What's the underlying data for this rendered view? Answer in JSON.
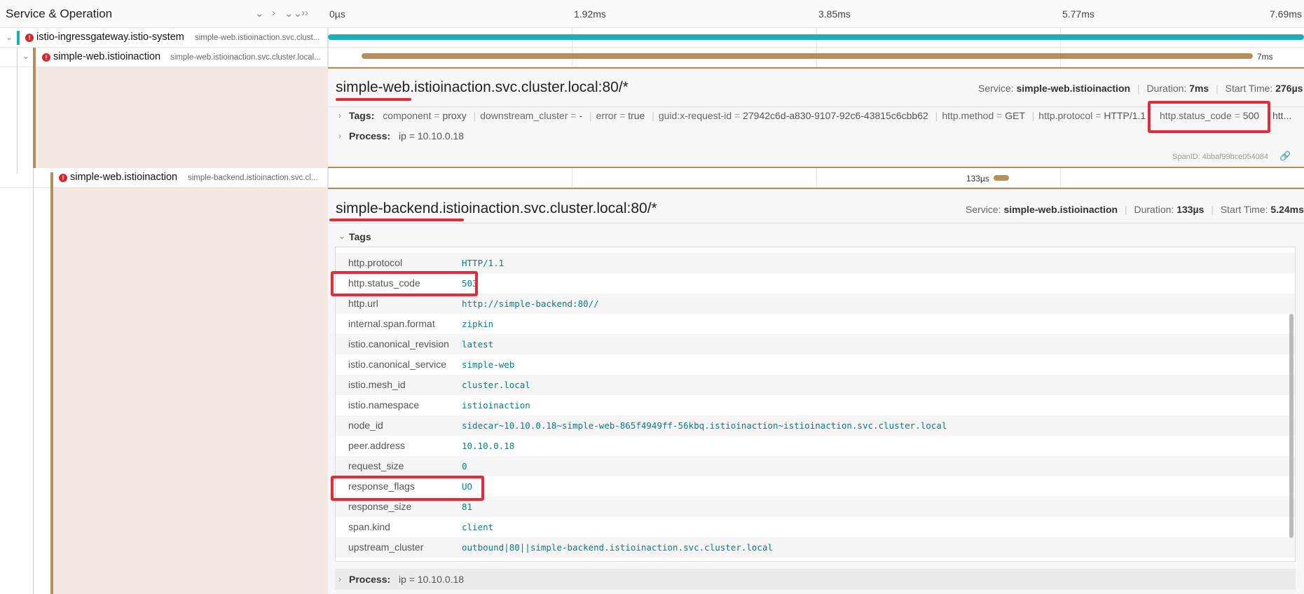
{
  "header": {
    "title": "Service & Operation",
    "controls": [
      "⌄",
      "›",
      "⌄⌄",
      "››"
    ],
    "ticks": [
      "0µs",
      "1.92ms",
      "3.85ms",
      "5.77ms",
      "7.69ms"
    ]
  },
  "spans": [
    {
      "service": "istio-ingressgateway.istio-system",
      "operation": "simple-web.istioinaction.svc.clust...",
      "color": "#1bb0b6"
    },
    {
      "service": "simple-web.istioinaction",
      "operation": "simple-web.istioinaction.svc.cluster.local...",
      "duration": "7ms",
      "color": "#b58e5e"
    },
    {
      "service": "simple-web.istioinaction",
      "operation": "simple-backend.istioinaction.svc.cl...",
      "duration": "133µs",
      "color": "#b58e5e"
    }
  ],
  "detail1": {
    "title": "simple-web.istioinaction.svc.cluster.local:80/*",
    "service_label": "Service:",
    "service": "simple-web.istioinaction",
    "duration_label": "Duration:",
    "duration": "7ms",
    "start_label": "Start Time:",
    "start": "276µs",
    "tags_label": "Tags:",
    "tags": [
      {
        "k": "component",
        "v": "proxy"
      },
      {
        "k": "downstream_cluster",
        "v": "-"
      },
      {
        "k": "error",
        "v": "true"
      },
      {
        "k": "guid:x-request-id",
        "v": "27942c6d-a830-9107-92c6-43815c6cbb62"
      },
      {
        "k": "http.method",
        "v": "GET"
      },
      {
        "k": "http.protocol",
        "v": "HTTP/1.1"
      },
      {
        "k": "http.status_code",
        "v": "500"
      }
    ],
    "tags_trailing": "htt...",
    "process_label": "Process:",
    "process": "ip = 10.10.0.18",
    "span_id": "SpanID: 4bbaf99bce054084"
  },
  "detail2": {
    "title": "simple-backend.istioinaction.svc.cluster.local:80/*",
    "service_label": "Service:",
    "service": "simple-web.istioinaction",
    "duration_label": "Duration:",
    "duration": "133µs",
    "start_label": "Start Time:",
    "start": "5.24ms",
    "tags_label": "Tags",
    "process_label": "Process:",
    "process": "ip = 10.10.0.18",
    "rows": [
      {
        "k": "http.protocol",
        "v": "HTTP/1.1"
      },
      {
        "k": "http.status_code",
        "v": "503"
      },
      {
        "k": "http.url",
        "v": "http://simple-backend:80//"
      },
      {
        "k": "internal.span.format",
        "v": "zipkin"
      },
      {
        "k": "istio.canonical_revision",
        "v": "latest"
      },
      {
        "k": "istio.canonical_service",
        "v": "simple-web"
      },
      {
        "k": "istio.mesh_id",
        "v": "cluster.local"
      },
      {
        "k": "istio.namespace",
        "v": "istioinaction"
      },
      {
        "k": "node_id",
        "v": "sidecar~10.10.0.18~simple-web-865f4949ff-56kbq.istioinaction~istioinaction.svc.cluster.local"
      },
      {
        "k": "peer.address",
        "v": "10.10.0.18"
      },
      {
        "k": "request_size",
        "v": "0"
      },
      {
        "k": "response_flags",
        "v": "UO"
      },
      {
        "k": "response_size",
        "v": "81"
      },
      {
        "k": "span.kind",
        "v": "client"
      },
      {
        "k": "upstream_cluster",
        "v": "outbound|80||simple-backend.istioinaction.svc.cluster.local"
      }
    ]
  }
}
